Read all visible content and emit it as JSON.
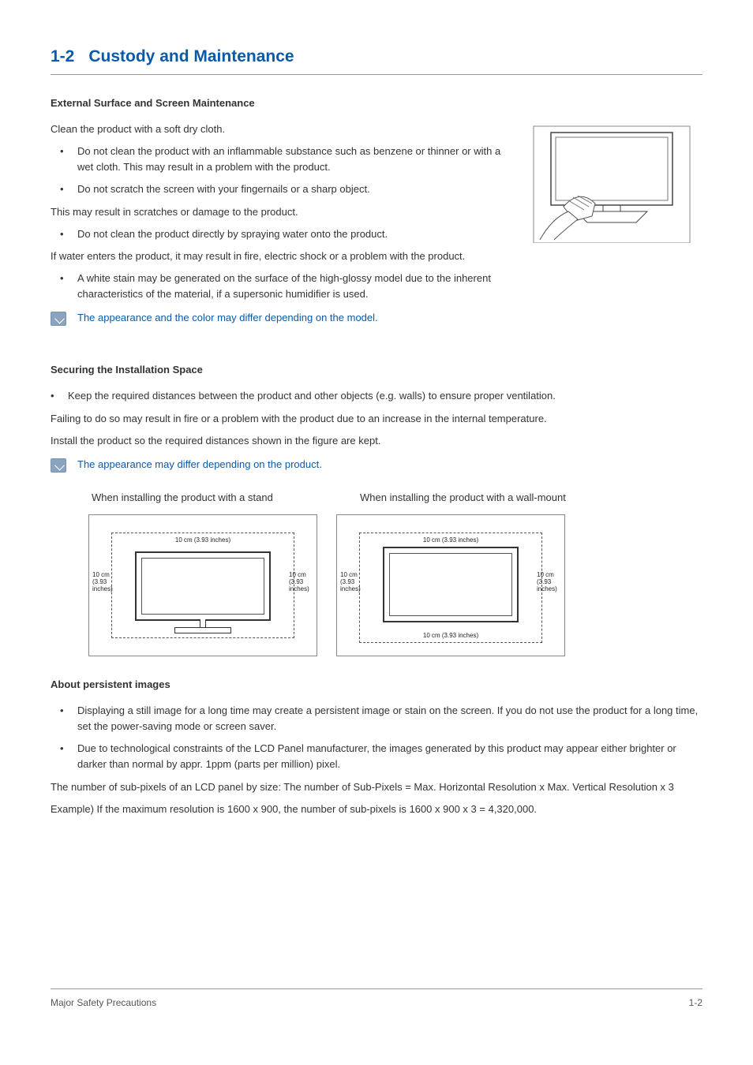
{
  "title": {
    "num": "1-2",
    "text": "Custody and Maintenance"
  },
  "section1": {
    "heading": "External Surface and Screen Maintenance",
    "intro": "Clean the product with a soft dry cloth.",
    "b1": "Do not clean the product with an inflammable substance such as benzene or thinner or with a wet cloth. This may result in a problem with the product.",
    "b2": "Do not scratch the screen with your fingernails or a sharp object.",
    "after_b2": "This may result in scratches or damage to the product.",
    "b3": "Do not clean the product directly by spraying water onto the product.",
    "after_b3": "If water enters the product, it may result in fire, electric shock or a problem with the product.",
    "b4": "A white stain may be generated on the surface of the high-glossy model due to the inherent characteristics of the material, if a supersonic humidifier is used.",
    "note": "The appearance and the color may differ depending on the model."
  },
  "section2": {
    "heading": "Securing the Installation Space",
    "b1": "Keep the required distances between the product and other objects (e.g. walls) to ensure proper ventilation.",
    "p1": "Failing to do so may result in fire or a problem with the product due to an increase in the internal temperature.",
    "p2": "Install the product so the required distances shown in the figure are kept.",
    "note": "The appearance may differ depending on the product.",
    "cap1": "When installing the product with a stand",
    "cap2": "When installing the product with a wall-mount",
    "dist_top": "10 cm (3.93 inches)",
    "dist_side": "10 cm (3.93 inches)",
    "dist_bottom": "10 cm (3.93 inches)"
  },
  "section3": {
    "heading": "About persistent images",
    "b1": "Displaying a still image for a long time may create a persistent image or stain on the screen. If you do not use the product for a long time, set the power-saving mode or screen saver.",
    "b2": "Due to technological constraints of the LCD Panel manufacturer, the images generated by this product may appear either brighter or darker than normal by appr. 1ppm (parts per million) pixel.",
    "p1": "The number of sub-pixels of an LCD panel by size:  The number of Sub-Pixels = Max. Horizontal Resolution x Max. Vertical Resolution x 3",
    "p2": "Example) If the maximum resolution is 1600 x 900, the number of sub-pixels is 1600 x 900 x 3 = 4,320,000."
  },
  "footer": {
    "left": "Major Safety Precautions",
    "right": "1-2"
  }
}
